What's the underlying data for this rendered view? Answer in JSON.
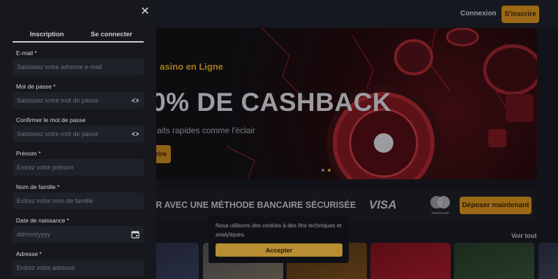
{
  "header": {
    "login_label": "Connexion",
    "signup_label": "S'inscrire"
  },
  "hero": {
    "subtitle": "asino en Ligne",
    "title": "0% DE CASHBACK",
    "description": "aits rapides comme l'éclair",
    "button_label": "rire"
  },
  "payment": {
    "text": "ER AVEC UNE MÉTHODE BANCAIRE SÉCURISÉE",
    "visa_label": "VISA",
    "mastercard_label": "mastercard",
    "deposit_label": "Déposer maintenant"
  },
  "games": {
    "see_all_label": "Voir tout"
  },
  "cookie": {
    "text": "Nous utilisons des cookies à des fins techniques et analytiques.",
    "accept_label": "Accepter"
  },
  "signup": {
    "tabs": [
      {
        "label": "Inscription",
        "active": true
      },
      {
        "label": "Se connecter",
        "active": false
      }
    ],
    "fields": [
      {
        "label": "E-mail *",
        "placeholder": "Saisissez votre adresse e-mail",
        "icon": "none"
      },
      {
        "label": "Mot de passe *",
        "placeholder": "Saisissez votre mot de passe",
        "icon": "eye-icon"
      },
      {
        "label": "Confirmer le mot de passe",
        "placeholder": "Saisissez votre mot de passe",
        "icon": "eye-icon"
      },
      {
        "label": "Prénom *",
        "placeholder": "Entrez votre prénom",
        "icon": "none"
      },
      {
        "label": "Nom de famille *",
        "placeholder": "Entrez votre nom de famille",
        "icon": "none"
      },
      {
        "label": "Date de naissance *",
        "placeholder": "dd/mm/yyyy",
        "icon": "calendar-icon"
      },
      {
        "label": "Adresse *",
        "placeholder": "Entrez votre adresse",
        "icon": "none"
      }
    ]
  },
  "colors": {
    "accent": "#9c6a16",
    "panel": "#16181e",
    "field": "#1f2128"
  }
}
